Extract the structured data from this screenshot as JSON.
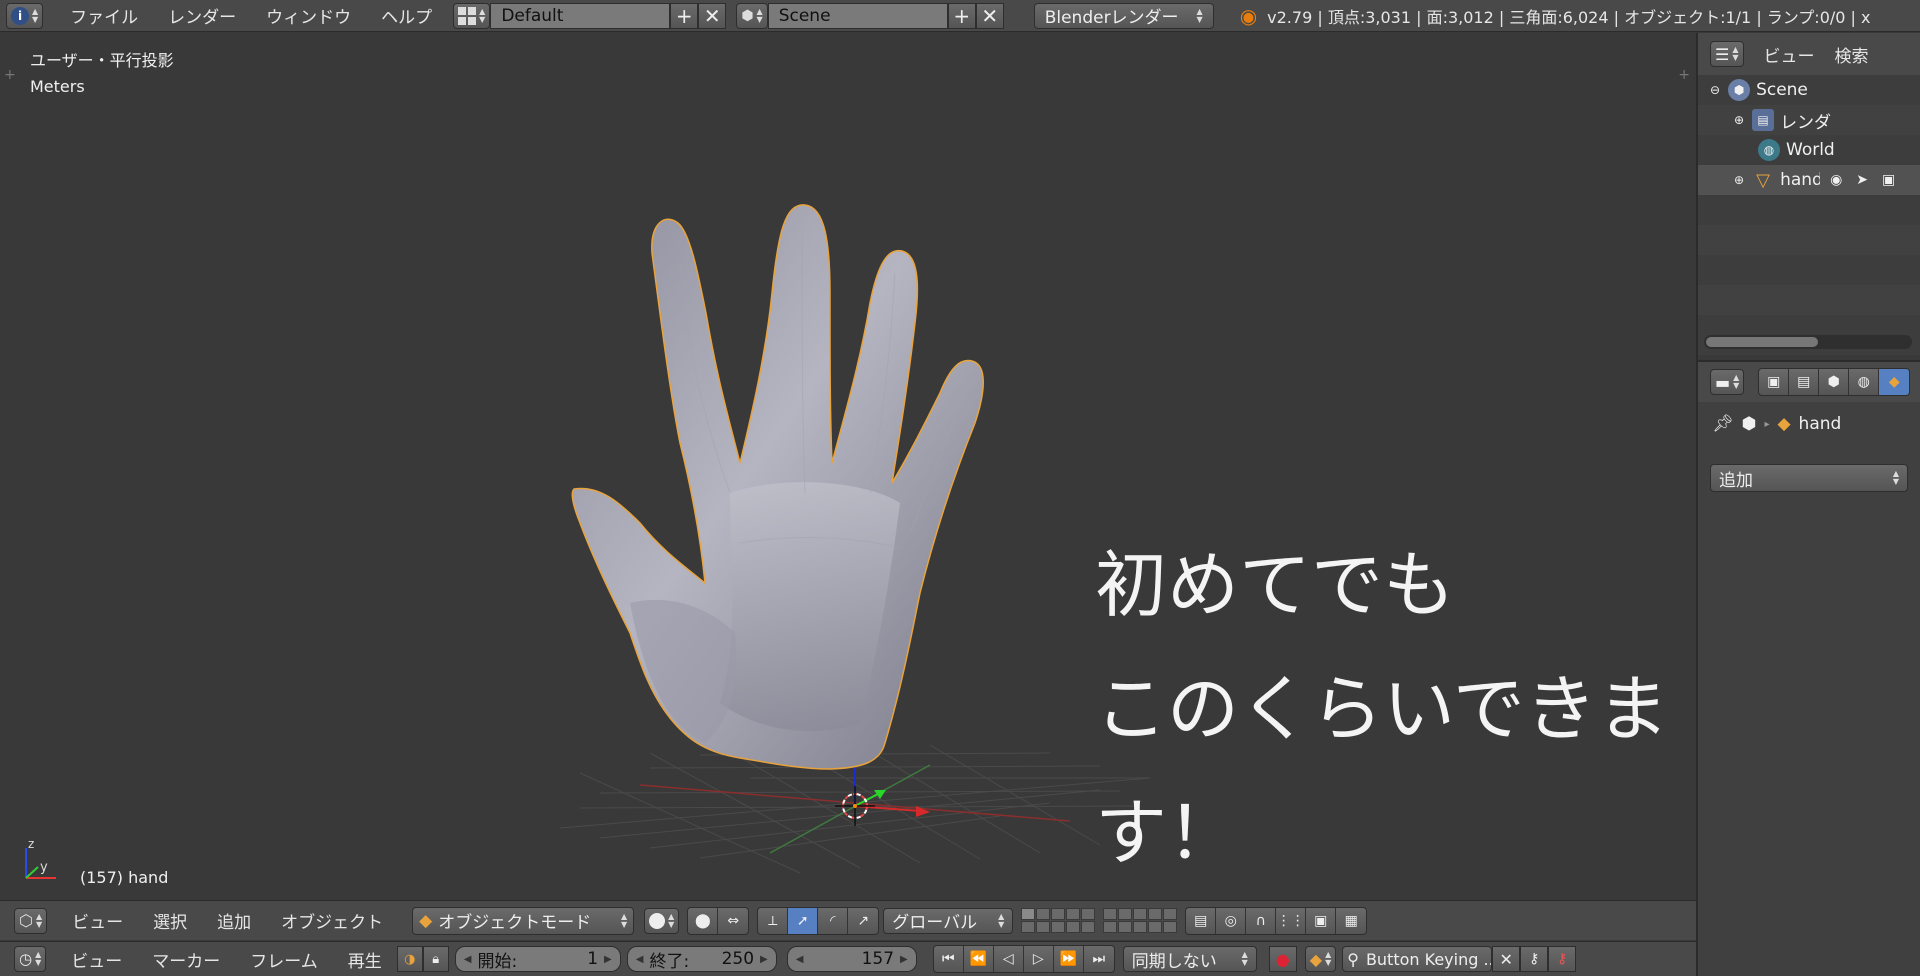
{
  "topbar": {
    "menus": [
      "ファイル",
      "レンダー",
      "ウィンドウ",
      "ヘルプ"
    ],
    "layout_name": "Default",
    "scene_name": "Scene",
    "render_engine": "Blenderレンダー",
    "stats": "v2.79 | 頂点:3,031 | 面:3,012 | 三角面:6,024 | オブジェクト:1/1 | ランプ:0/0 | x"
  },
  "viewport": {
    "view_label": "ユーザー・平行投影",
    "units_label": "Meters",
    "overlay_line1": "初めてでも",
    "overlay_line2": "このくらいできます！",
    "frame_label": "(157) hand",
    "axis_z": "z",
    "axis_y": "y"
  },
  "view3d_header": {
    "menus": [
      "ビュー",
      "選択",
      "追加",
      "オブジェクト"
    ],
    "mode": "オブジェクトモード",
    "orientation": "グローバル"
  },
  "timeline": {
    "menus": [
      "ビュー",
      "マーカー",
      "フレーム",
      "再生"
    ],
    "start_label": "開始:",
    "start_value": "1",
    "end_label": "終了:",
    "end_value": "250",
    "current_frame": "157",
    "sync": "同期しない",
    "keying_set": "Button Keying ..."
  },
  "outliner": {
    "header_view": "ビュー",
    "header_search": "検索",
    "rows": [
      {
        "label": "Scene"
      },
      {
        "label": "レンダ"
      },
      {
        "label": "World"
      },
      {
        "label": "hand"
      }
    ]
  },
  "properties": {
    "object_name": "hand",
    "add_label": "追加"
  },
  "colors": {
    "selection_outline": "#e8a33d",
    "active_blue": "#5680c2"
  }
}
